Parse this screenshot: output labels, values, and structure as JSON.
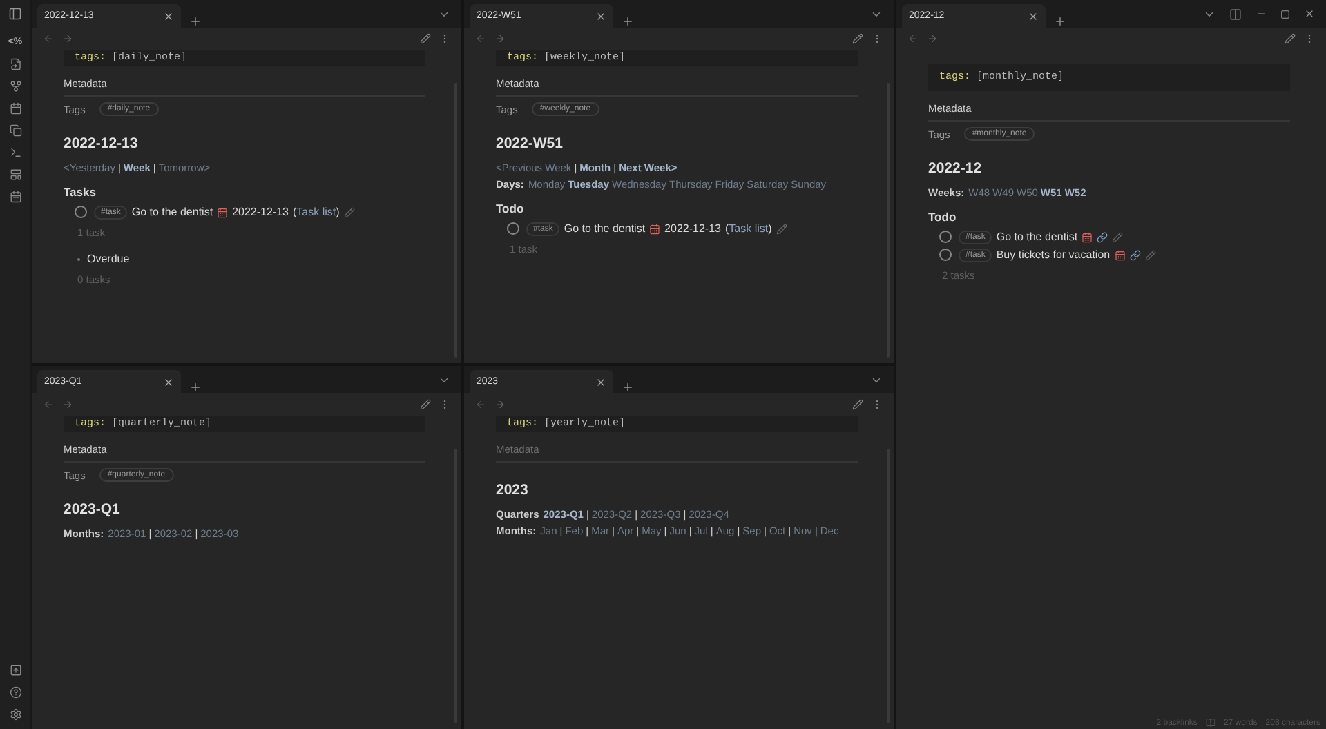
{
  "ribbon": {
    "template_label": "<%"
  },
  "panes": [
    {
      "tab": "2022-12-13",
      "frontmatter": {
        "key": "tags:",
        "value": "[daily_note]"
      },
      "metadata": {
        "label": "Metadata",
        "dimmed": false
      },
      "tags": {
        "label": "Tags",
        "tag": "#daily_note"
      },
      "title": "2022-12-13",
      "blocks": [
        {
          "kind": "links",
          "separator": "|",
          "items": [
            {
              "text": "<Yesterday",
              "highlighted": false
            },
            {
              "text": "Week",
              "highlighted": true
            },
            {
              "text": "Tomorrow>",
              "highlighted": false
            }
          ]
        },
        {
          "kind": "heading",
          "text": "Tasks"
        },
        {
          "kind": "tasks",
          "items": [
            {
              "tag": "#task",
              "text": "Go to the dentist",
              "due": "2022-12-13",
              "backlink": {
                "before": "(",
                "link": "Task list",
                "after": ")"
              },
              "checked": false
            }
          ],
          "count": "1 task"
        },
        {
          "kind": "group",
          "text": "Overdue",
          "count": "0 tasks"
        }
      ]
    },
    {
      "tab": "2022-W51",
      "frontmatter": {
        "key": "tags:",
        "value": "[weekly_note]"
      },
      "metadata": {
        "label": "Metadata",
        "dimmed": false
      },
      "tags": {
        "label": "Tags",
        "tag": "#weekly_note"
      },
      "title": "2022-W51",
      "blocks": [
        {
          "kind": "links",
          "separator": "|",
          "items": [
            {
              "text": "<Previous Week",
              "highlighted": false
            },
            {
              "text": "Month",
              "highlighted": true
            },
            {
              "text": "Next Week>",
              "highlighted": true
            }
          ]
        },
        {
          "kind": "links",
          "label": "Days:",
          "items": [
            {
              "text": "Monday",
              "highlighted": false
            },
            {
              "text": "Tuesday",
              "highlighted": true
            },
            {
              "text": "Wednesday",
              "highlighted": false
            },
            {
              "text": "Thursday",
              "highlighted": false
            },
            {
              "text": "Friday",
              "highlighted": false
            },
            {
              "text": "Saturday",
              "highlighted": false
            },
            {
              "text": "Sunday",
              "highlighted": false
            }
          ]
        },
        {
          "kind": "heading",
          "text": "Todo"
        },
        {
          "kind": "tasks",
          "items": [
            {
              "tag": "#task",
              "text": "Go to the dentist",
              "due": "2022-12-13",
              "backlink": {
                "before": "(",
                "link": "Task list",
                "after": ")"
              },
              "checked": false
            }
          ],
          "count": "1 task"
        }
      ]
    },
    {
      "tab": "2022-12",
      "frontmatter": {
        "key": "tags:",
        "value": "[monthly_note]"
      },
      "metadata": {
        "label": "Metadata",
        "dimmed": false
      },
      "tags": {
        "label": "Tags",
        "tag": "#monthly_note"
      },
      "title": "2022-12",
      "blocks": [
        {
          "kind": "links",
          "label": "Weeks:",
          "items": [
            {
              "text": "W48",
              "highlighted": false
            },
            {
              "text": "W49",
              "highlighted": false
            },
            {
              "text": "W50",
              "highlighted": false
            },
            {
              "text": "W51",
              "highlighted": true
            },
            {
              "text": "W52",
              "highlighted": true
            }
          ]
        },
        {
          "kind": "heading",
          "text": "Todo"
        },
        {
          "kind": "tasks",
          "items": [
            {
              "tag": "#task",
              "text": "Go to the dentist",
              "checked": false
            },
            {
              "tag": "#task",
              "text": "Buy tickets for vacation",
              "checked": false
            }
          ],
          "count": "2 tasks"
        }
      ]
    },
    {
      "tab": "2023-Q1",
      "frontmatter": {
        "key": "tags:",
        "value": "[quarterly_note]"
      },
      "metadata": {
        "label": "Metadata",
        "dimmed": false
      },
      "tags": {
        "label": "Tags",
        "tag": "#quarterly_note"
      },
      "title": "2023-Q1",
      "blocks": [
        {
          "kind": "links",
          "label": "Months:",
          "separator": "|",
          "items": [
            {
              "text": "2023-01",
              "highlighted": false
            },
            {
              "text": "2023-02",
              "highlighted": false
            },
            {
              "text": "2023-03",
              "highlighted": false
            }
          ]
        }
      ]
    },
    {
      "tab": "2023",
      "frontmatter": {
        "key": "tags:",
        "value": "[yearly_note]"
      },
      "metadata": {
        "label": "Metadata",
        "dimmed": true
      },
      "title": "2023",
      "blocks": [
        {
          "kind": "links",
          "label": "Quarters",
          "separator": "|",
          "items": [
            {
              "text": "2023-Q1",
              "highlighted": true
            },
            {
              "text": "2023-Q2",
              "highlighted": false
            },
            {
              "text": "2023-Q3",
              "highlighted": false
            },
            {
              "text": "2023-Q4",
              "highlighted": false
            }
          ]
        },
        {
          "kind": "links",
          "label": "Months:",
          "separator": "|",
          "items": [
            {
              "text": "Jan",
              "highlighted": false
            },
            {
              "text": "Feb",
              "highlighted": false
            },
            {
              "text": "Mar",
              "highlighted": false
            },
            {
              "text": "Apr",
              "highlighted": false
            },
            {
              "text": "May",
              "highlighted": false
            },
            {
              "text": "Jun",
              "highlighted": false
            },
            {
              "text": "Jul",
              "highlighted": false
            },
            {
              "text": "Aug",
              "highlighted": false
            },
            {
              "text": "Sep",
              "highlighted": false
            },
            {
              "text": "Oct",
              "highlighted": false
            },
            {
              "text": "Nov",
              "highlighted": false
            },
            {
              "text": "Dec",
              "highlighted": false
            }
          ]
        }
      ]
    }
  ],
  "status_bar": {
    "backlinks": "2 backlinks",
    "words": "27 words",
    "characters": "208 characters"
  }
}
